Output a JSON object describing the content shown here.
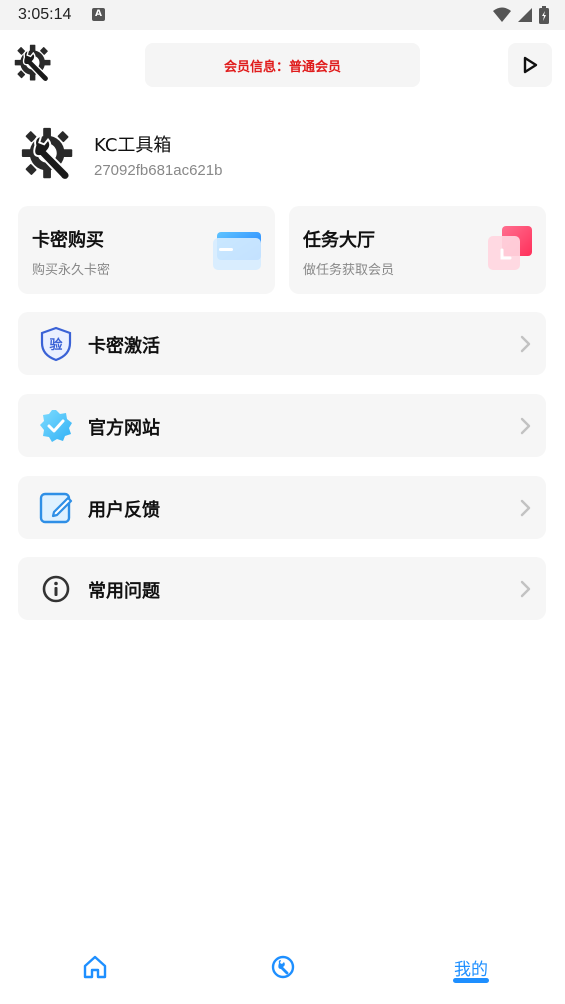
{
  "status_bar": {
    "time": "3:05:14",
    "notification_glyph": "A",
    "icons": [
      "wifi-icon",
      "signal-icon",
      "battery-icon"
    ]
  },
  "top_bar": {
    "logo_icon": "wrench-gear-icon",
    "member_info": "会员信息：普通会员",
    "play_icon": "play-icon",
    "member_color": "#e01b1b"
  },
  "profile": {
    "avatar_icon": "wrench-gear-icon",
    "name": "KC工具箱",
    "id": "27092fb681ac621b"
  },
  "cards": [
    {
      "title": "卡密购买",
      "subtitle": "购买永久卡密",
      "icon": "card-icon"
    },
    {
      "title": "任务大厅",
      "subtitle": "做任务获取会员",
      "icon": "task-icon"
    }
  ],
  "menu": [
    {
      "label": "卡密激活",
      "icon": "verify-shield-icon",
      "icon_text": "验"
    },
    {
      "label": "官方网站",
      "icon": "verified-badge-icon"
    },
    {
      "label": "用户反馈",
      "icon": "edit-note-icon"
    },
    {
      "label": "常用问题",
      "icon": "info-icon"
    }
  ],
  "bottom_nav": {
    "home_icon": "home-icon",
    "tools_icon": "tools-icon",
    "mine_label": "我的",
    "accent": "#1e8fff"
  }
}
